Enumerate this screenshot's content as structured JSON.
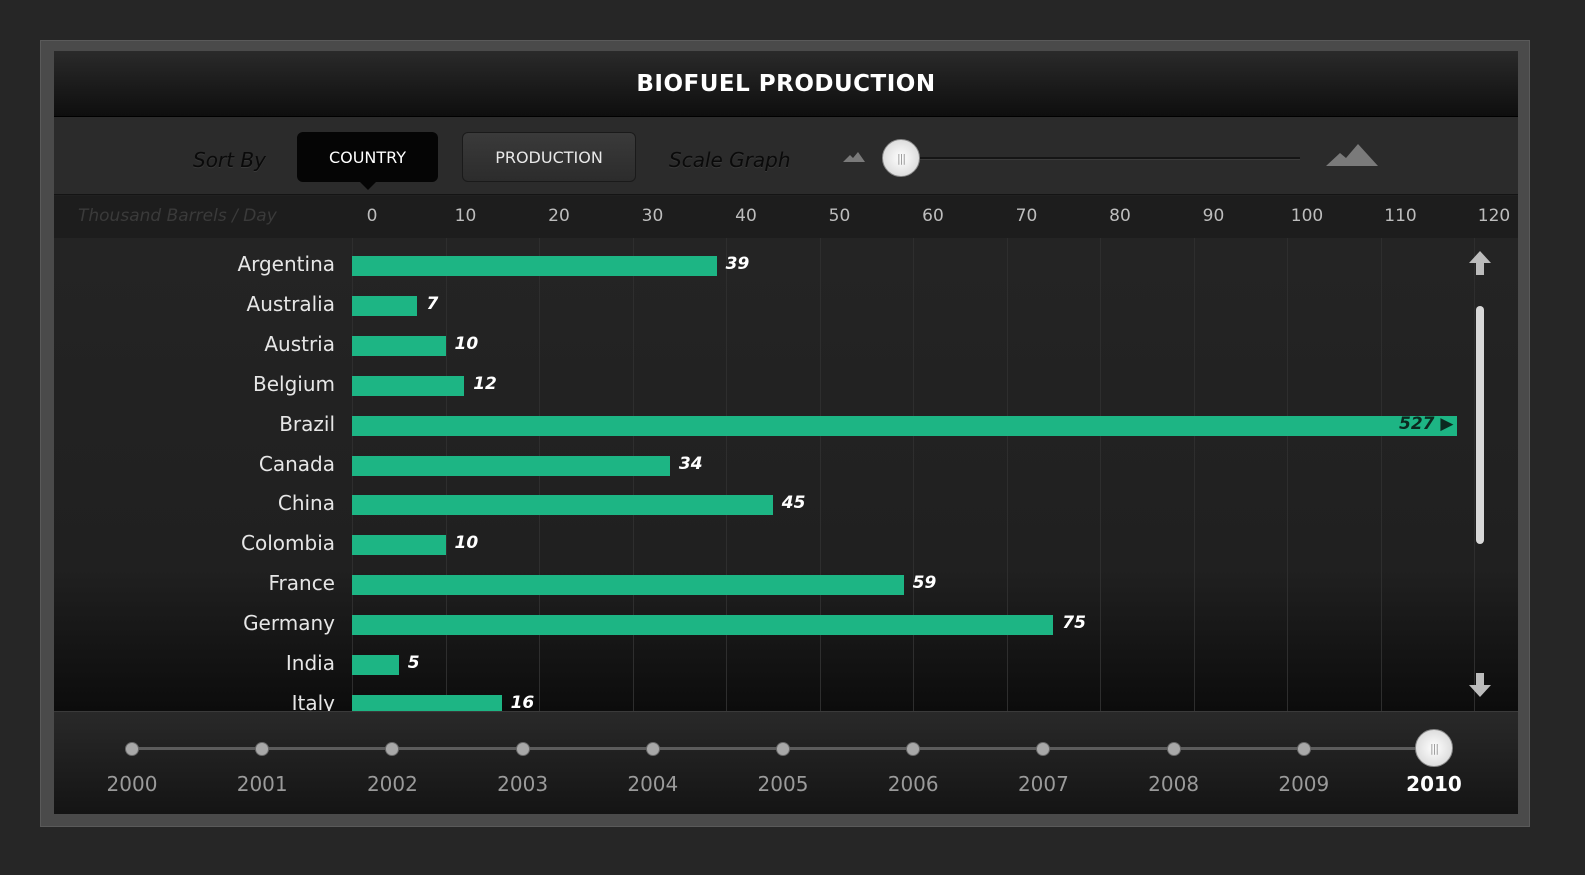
{
  "title": "BIOFUEL PRODUCTION",
  "toolbar": {
    "sort_by_label": "Sort By",
    "country_label": "COUNTRY",
    "production_label": "PRODUCTION",
    "scale_graph_label": "Scale Graph",
    "active_sort": "country",
    "scale_level": 0
  },
  "colors": {
    "bar": "#1db584",
    "accent": "#ffffff",
    "background": "#202020"
  },
  "chart_data": {
    "type": "bar",
    "orientation": "horizontal",
    "xlabel": "Thousand Barrels / Day",
    "xlim": [
      0,
      120
    ],
    "x_ticks": [
      "0",
      "10",
      "20",
      "30",
      "40",
      "50",
      "60",
      "70",
      "80",
      "90",
      "100",
      "110",
      "120"
    ],
    "grid": true,
    "categories": [
      "Argentina",
      "Australia",
      "Austria",
      "Belgium",
      "Brazil",
      "Canada",
      "China",
      "Colombia",
      "France",
      "Germany",
      "India",
      "Italy"
    ],
    "values": [
      39,
      7,
      10,
      12,
      527,
      34,
      45,
      10,
      59,
      75,
      5,
      16
    ],
    "value_labels": [
      "39",
      "7",
      "10",
      "12",
      "527",
      "34",
      "45",
      "10",
      "59",
      "75",
      "5",
      "16"
    ],
    "overflow_categories": [
      "Brazil"
    ]
  },
  "timeline": {
    "years": [
      "2000",
      "2001",
      "2002",
      "2003",
      "2004",
      "2005",
      "2006",
      "2007",
      "2008",
      "2009",
      "2010"
    ],
    "selected": "2010"
  },
  "icons": {
    "scroll_up": "arrow-up-icon",
    "scroll_down": "arrow-down-icon",
    "scale_small": "mountain-small-icon",
    "scale_large": "mountain-large-icon",
    "knob_grip": "grip-icon"
  }
}
